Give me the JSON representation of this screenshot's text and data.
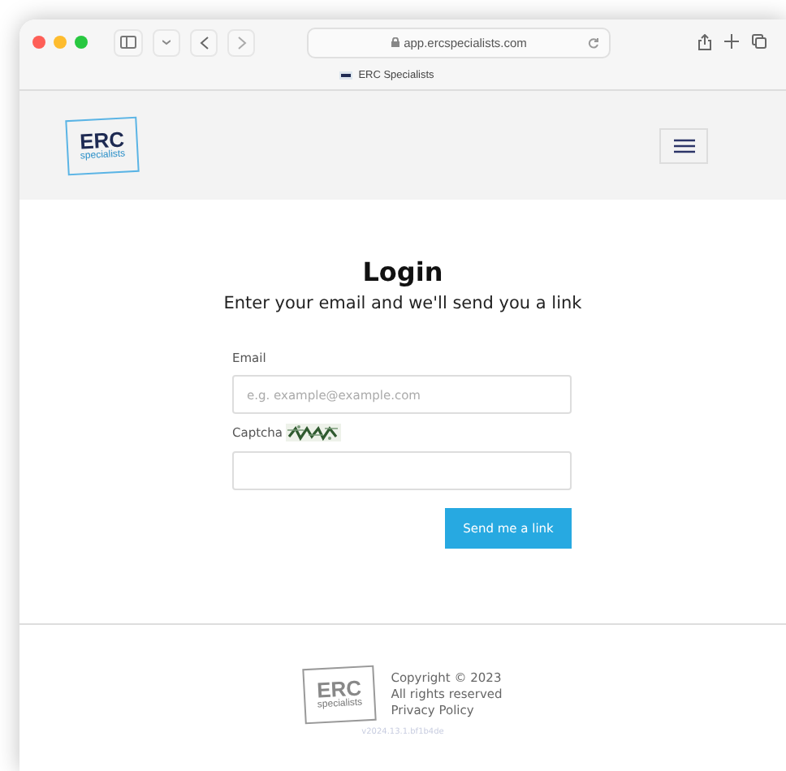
{
  "browser": {
    "url": "app.ercspecialists.com",
    "tab_title": "ERC Specialists"
  },
  "header": {
    "logo": "ERC",
    "logo_sub": "specialists"
  },
  "login": {
    "title": "Login",
    "subtitle": "Enter your email and we'll send you a link",
    "email_label": "Email",
    "email_placeholder": "e.g. example@example.com",
    "captcha_label": "Captcha",
    "button": "Send me a link"
  },
  "footer": {
    "logo": "ERC",
    "logo_sub": "specialists",
    "lines": [
      "Copyright © 2023",
      "All rights reserved",
      "Privacy Policy"
    ],
    "version": "v2024.13.1.bf1b4de"
  }
}
